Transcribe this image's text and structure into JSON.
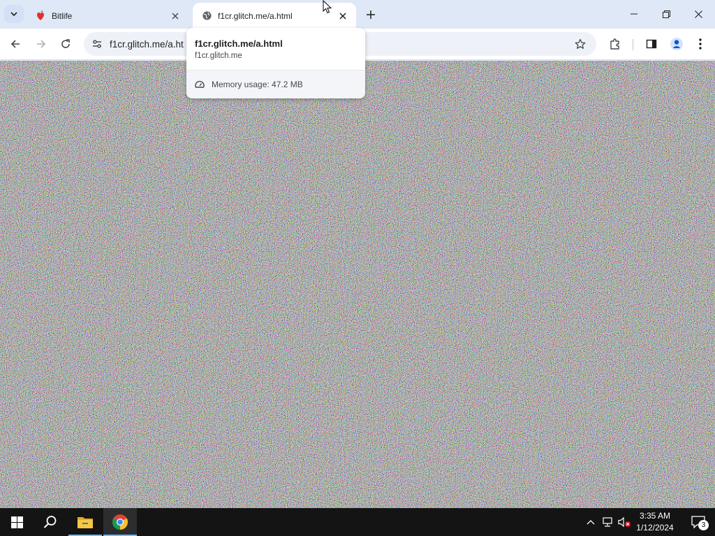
{
  "browser": {
    "tabs": [
      {
        "title": "Bitlife",
        "favicon": "bitlife-icon",
        "active": false
      },
      {
        "title": "f1cr.glitch.me/a.html",
        "favicon": "globe-icon",
        "active": true
      }
    ],
    "address_bar": {
      "url": "f1cr.glitch.me/a.html",
      "visible_text": "f1cr.glitch.me/a.ht"
    },
    "hover_card": {
      "title": "f1cr.glitch.me/a.html",
      "domain": "f1cr.glitch.me",
      "memory_usage": "Memory usage: 47.2 MB"
    }
  },
  "page": {
    "content": "random color static noise"
  },
  "taskbar": {
    "clock_time": "3:35 AM",
    "clock_date": "1/12/2024",
    "notification_count": "3",
    "pinned": [
      "start-icon",
      "search-icon",
      "file-explorer-icon",
      "chrome-icon"
    ]
  },
  "colors": {
    "tabstrip": "#dfe8f7",
    "toolbar": "#ffffff",
    "omnibox": "#eef2f8",
    "taskbar": "#141414",
    "accent": "#76b9ed"
  }
}
